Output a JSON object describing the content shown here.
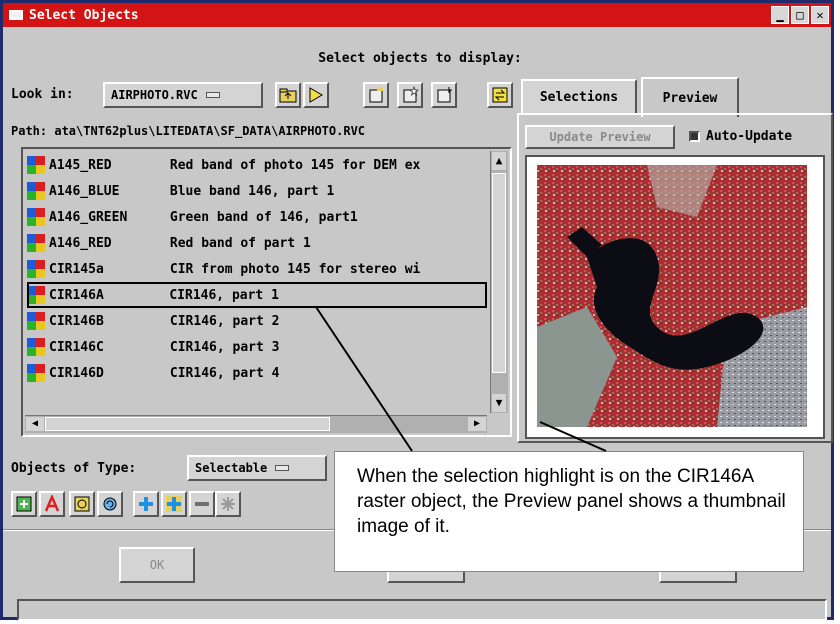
{
  "window": {
    "title": "Select Objects",
    "controls": [
      "minimize",
      "maximize",
      "close"
    ]
  },
  "heading": "Select objects to display:",
  "look_in": {
    "label": "Look in:",
    "value": "AIRPHOTO.RVC"
  },
  "toolbar_icons": [
    "folder-up-icon",
    "navigate-icon",
    "new-file-icon",
    "new-file-star-icon",
    "new-file-sparkle-icon",
    "swap-icon"
  ],
  "path": {
    "label": "Path:",
    "value": "ata\\TNT62plus\\LITEDATA\\SF_DATA\\AIRPHOTO.RVC"
  },
  "objects": [
    {
      "name": "A145_RED",
      "description": "Red band of photo 145 for DEM ex"
    },
    {
      "name": "A146_BLUE",
      "description": "Blue band 146, part 1"
    },
    {
      "name": "A146_GREEN",
      "description": "Green band of 146, part1"
    },
    {
      "name": "A146_RED",
      "description": "Red band of part 1"
    },
    {
      "name": "CIR145a",
      "description": "CIR from photo 145 for stereo wi"
    },
    {
      "name": "CIR146A",
      "description": "CIR146, part 1",
      "selected": true
    },
    {
      "name": "CIR146B",
      "description": "CIR146, part 2"
    },
    {
      "name": "CIR146C",
      "description": "CIR146, part 3"
    },
    {
      "name": "CIR146D",
      "description": "CIR146, part 4"
    }
  ],
  "tabs": {
    "selections": "Selections",
    "preview": "Preview",
    "active": "Preview"
  },
  "preview": {
    "update_label": "Update Preview",
    "auto_update_label": "Auto-Update",
    "auto_update_checked": true
  },
  "objects_of_type": {
    "label": "Objects of Type:",
    "value": "Selectable"
  },
  "action_icons": [
    "add-object-icon",
    "raster-a-icon",
    "tag-icon",
    "refresh-icon",
    "add-plus-icon",
    "add-plus-yellow-icon",
    "remove-minus-icon",
    "remove-all-icon"
  ],
  "buttons": {
    "ok": "OK"
  },
  "callout": {
    "text": "When the selection highlight is on the CIR146A raster object, the Preview panel shows a thumbnail image of it."
  },
  "colors": {
    "titlebar": "#d21414",
    "window_bg": "#c8c8c8",
    "preview_water": "#0c0c14",
    "preview_vegetation": "#c83c5a"
  }
}
